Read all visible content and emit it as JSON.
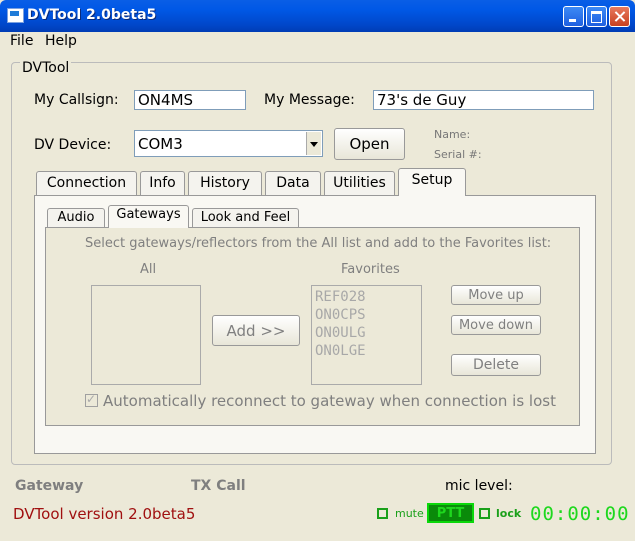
{
  "window": {
    "title": "DVTool 2.0beta5"
  },
  "menu": {
    "items": [
      "File",
      "Help"
    ]
  },
  "group": {
    "label": "DVTool"
  },
  "callsign": {
    "label": "My Callsign:",
    "value": "ON4MS"
  },
  "message": {
    "label": "My Message:",
    "value": "73's de Guy"
  },
  "device": {
    "label": "DV Device:",
    "value": "COM3",
    "open_label": "Open",
    "name_label": "Name:",
    "serial_label": "Serial #:"
  },
  "tabs": [
    "Connection",
    "Info",
    "History",
    "Data",
    "Utilities",
    "Setup"
  ],
  "active_tab": "Setup",
  "subtabs": [
    "Audio",
    "Gateways",
    "Look and Feel"
  ],
  "active_subtab": "Gateways",
  "gateways": {
    "instruction": "Select gateways/reflectors from the All list and add to the Favorites list:",
    "all_label": "All",
    "favorites_label": "Favorites",
    "all_items": [],
    "favorites": [
      "REF028",
      "ON0CPS",
      "ON0ULG",
      "ON0LGE"
    ],
    "add_label": "Add >>",
    "move_up_label": "Move up",
    "move_down_label": "Move down",
    "delete_label": "Delete",
    "auto_reconnect_label": "Automatically reconnect to gateway when connection is lost",
    "auto_reconnect_checked": true
  },
  "status": {
    "gateway_label": "Gateway",
    "txcall_label": "TX Call",
    "mic_label": "mic level:",
    "version": "DVTool version 2.0beta5",
    "mute_label": "mute",
    "ptt_label": "PTT",
    "lock_label": "lock",
    "timer": "00:00:00"
  },
  "colors": {
    "accent_green": "#1ed81e",
    "version_red": "#a01010",
    "title_blue": "#0058e6"
  }
}
